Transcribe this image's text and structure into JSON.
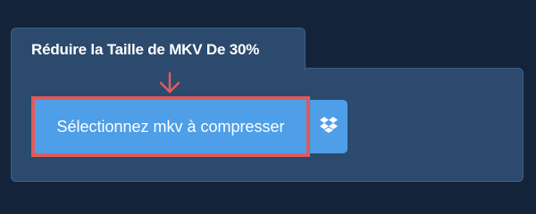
{
  "title": "Réduire la Taille de MKV De 30%",
  "upload": {
    "button_label": "Sélectionnez mkv à compresser",
    "dropbox_icon": "dropbox-icon",
    "arrow_icon": "arrow-down-icon"
  },
  "colors": {
    "background": "#13243a",
    "panel": "#2b4a6d",
    "button": "#4e9ee8",
    "highlight": "#e05a5a"
  }
}
